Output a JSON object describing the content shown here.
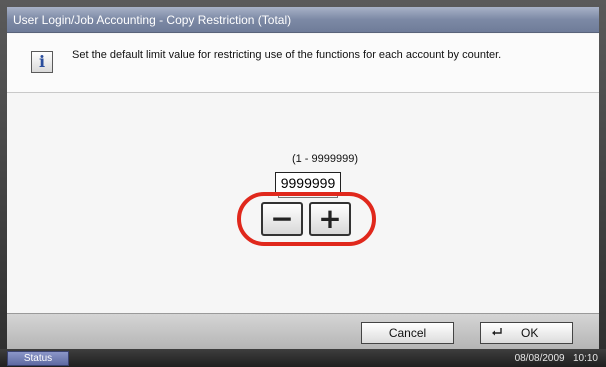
{
  "window": {
    "title": "User Login/Job Accounting - Copy Restriction (Total)"
  },
  "info": {
    "icon": "info-icon",
    "icon_glyph": "i",
    "message": "Set the default limit value for restricting use of the functions for each account by counter."
  },
  "counter": {
    "range_label": "(1 - 9999999)",
    "value": "9999999",
    "minus_label": "−",
    "plus_label": "+"
  },
  "footer": {
    "cancel_label": "Cancel",
    "ok_label": "OK"
  },
  "statusbar": {
    "status_label": "Status",
    "date": "08/08/2009",
    "time": "10:10"
  },
  "colors": {
    "title_bar": "#7c89a5",
    "highlight_ring": "#e0281c",
    "status_button": "#6f7bb2"
  }
}
